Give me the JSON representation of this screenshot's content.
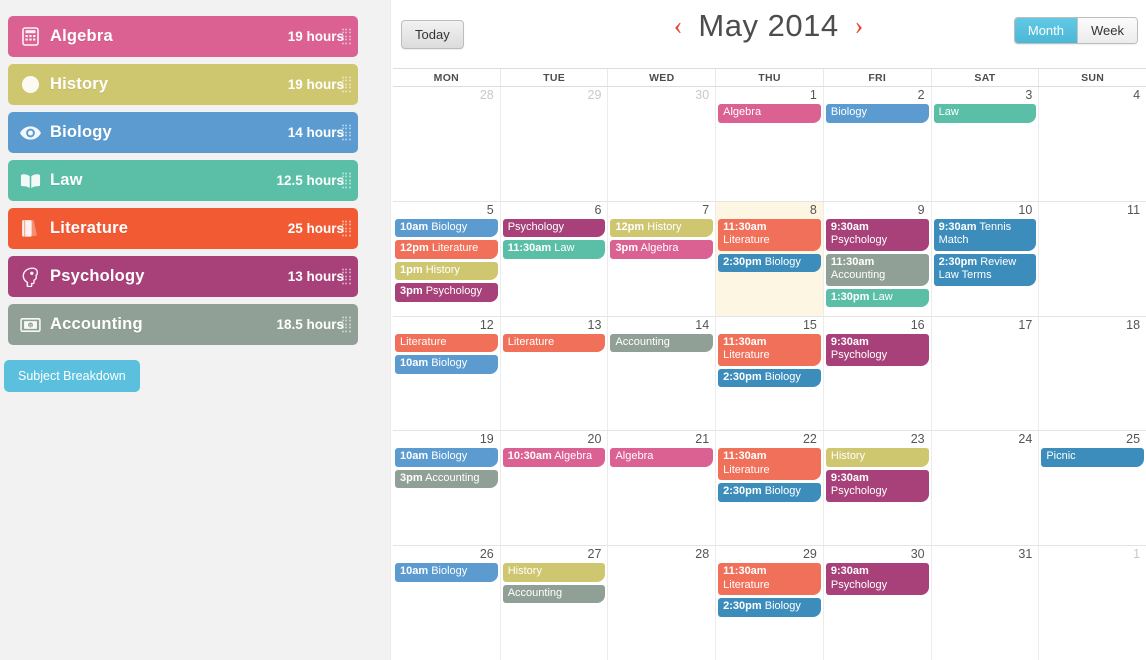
{
  "sidebar": {
    "subjects": [
      {
        "name": "Algebra",
        "hours": "19 hours",
        "color": "#da6191",
        "icon": "calculator-icon"
      },
      {
        "name": "History",
        "hours": "19 hours",
        "color": "#cfc670",
        "icon": "globe-icon"
      },
      {
        "name": "Biology",
        "hours": "14 hours",
        "color": "#5b9bd0",
        "icon": "eye-icon"
      },
      {
        "name": "Law",
        "hours": "12.5 hours",
        "color": "#5bbfa8",
        "icon": "open-book-icon"
      },
      {
        "name": "Literature",
        "hours": "25 hours",
        "color": "#f15a33",
        "icon": "books-icon"
      },
      {
        "name": "Psychology",
        "hours": "13 hours",
        "color": "#a8417a",
        "icon": "brain-icon"
      },
      {
        "name": "Accounting",
        "hours": "18.5 hours",
        "color": "#91a096",
        "icon": "money-icon"
      }
    ],
    "breakdown_button": "Subject Breakdown"
  },
  "toolbar": {
    "today_label": "Today",
    "prev_arrow": "‹",
    "next_arrow": "›",
    "title": "May 2014",
    "views": [
      {
        "label": "Month",
        "active": true
      },
      {
        "label": "Week",
        "active": false
      }
    ],
    "accent_color": "#e8432f",
    "active_view_color": "#4bb8d6"
  },
  "calendar": {
    "day_headers": [
      "MON",
      "TUE",
      "WED",
      "THU",
      "FRI",
      "SAT",
      "SUN"
    ],
    "event_colors": {
      "Algebra": "#da6191",
      "History": "#cfc670",
      "Biology": "#5b9bd0",
      "Law": "#5bbfa8",
      "Literature": "#f0705a",
      "Psychology": "#a8417a",
      "Accounting": "#91a096",
      "Other": "#3c8dbc"
    },
    "today": 8,
    "weeks": [
      [
        {
          "num": "28",
          "other": true,
          "events": []
        },
        {
          "num": "29",
          "other": true,
          "events": []
        },
        {
          "num": "30",
          "other": true,
          "events": []
        },
        {
          "num": "1",
          "other": false,
          "events": [
            {
              "time": "",
              "name": "Algebra",
              "color": "#da6191"
            }
          ]
        },
        {
          "num": "2",
          "other": false,
          "events": [
            {
              "time": "",
              "name": "Biology",
              "color": "#5b9bd0"
            }
          ]
        },
        {
          "num": "3",
          "other": false,
          "events": [
            {
              "time": "",
              "name": "Law",
              "color": "#5bbfa8"
            }
          ]
        },
        {
          "num": "4",
          "other": false,
          "events": []
        }
      ],
      [
        {
          "num": "5",
          "other": false,
          "events": [
            {
              "time": "10am",
              "name": "Biology",
              "color": "#5b9bd0"
            },
            {
              "time": "12pm",
              "name": "Literature",
              "color": "#f0705a"
            },
            {
              "time": "1pm",
              "name": "History",
              "color": "#cfc670"
            },
            {
              "time": "3pm",
              "name": "Psychology",
              "color": "#a8417a"
            }
          ]
        },
        {
          "num": "6",
          "other": false,
          "events": [
            {
              "time": "",
              "name": "Psychology",
              "color": "#a8417a"
            },
            {
              "time": "11:30am",
              "name": "Law",
              "color": "#5bbfa8"
            }
          ]
        },
        {
          "num": "7",
          "other": false,
          "events": [
            {
              "time": "12pm",
              "name": "History",
              "color": "#cfc670"
            },
            {
              "time": "3pm",
              "name": "Algebra",
              "color": "#da6191"
            }
          ]
        },
        {
          "num": "8",
          "other": false,
          "today": true,
          "events": [
            {
              "time": "11:30am",
              "name": "Literature",
              "color": "#f0705a"
            },
            {
              "time": "2:30pm",
              "name": "Biology",
              "color": "#3c8dbc"
            }
          ]
        },
        {
          "num": "9",
          "other": false,
          "events": [
            {
              "time": "9:30am",
              "name": "Psychology",
              "color": "#a8417a"
            },
            {
              "time": "11:30am",
              "name": "Accounting",
              "color": "#91a096"
            },
            {
              "time": "1:30pm",
              "name": "Law",
              "color": "#5bbfa8"
            }
          ]
        },
        {
          "num": "10",
          "other": false,
          "events": [
            {
              "time": "9:30am",
              "name": "Tennis Match",
              "color": "#3c8dbc"
            },
            {
              "time": "2:30pm",
              "name": "Review Law Terms",
              "color": "#3c8dbc"
            }
          ]
        },
        {
          "num": "11",
          "other": false,
          "events": []
        }
      ],
      [
        {
          "num": "12",
          "other": false,
          "events": [
            {
              "time": "",
              "name": "Literature",
              "color": "#f0705a"
            },
            {
              "time": "10am",
              "name": "Biology",
              "color": "#5b9bd0"
            }
          ]
        },
        {
          "num": "13",
          "other": false,
          "events": [
            {
              "time": "",
              "name": "Literature",
              "color": "#f0705a"
            }
          ]
        },
        {
          "num": "14",
          "other": false,
          "events": [
            {
              "time": "",
              "name": "Accounting",
              "color": "#91a096"
            }
          ]
        },
        {
          "num": "15",
          "other": false,
          "events": [
            {
              "time": "11:30am",
              "name": "Literature",
              "color": "#f0705a"
            },
            {
              "time": "2:30pm",
              "name": "Biology",
              "color": "#3c8dbc"
            }
          ]
        },
        {
          "num": "16",
          "other": false,
          "events": [
            {
              "time": "9:30am",
              "name": "Psychology",
              "color": "#a8417a"
            }
          ]
        },
        {
          "num": "17",
          "other": false,
          "events": []
        },
        {
          "num": "18",
          "other": false,
          "events": []
        }
      ],
      [
        {
          "num": "19",
          "other": false,
          "events": [
            {
              "time": "10am",
              "name": "Biology",
              "color": "#5b9bd0"
            },
            {
              "time": "3pm",
              "name": "Accounting",
              "color": "#91a096"
            }
          ]
        },
        {
          "num": "20",
          "other": false,
          "events": [
            {
              "time": "10:30am",
              "name": "Algebra",
              "color": "#da6191"
            }
          ]
        },
        {
          "num": "21",
          "other": false,
          "events": [
            {
              "time": "",
              "name": "Algebra",
              "color": "#da6191"
            }
          ]
        },
        {
          "num": "22",
          "other": false,
          "events": [
            {
              "time": "11:30am",
              "name": "Literature",
              "color": "#f0705a"
            },
            {
              "time": "2:30pm",
              "name": "Biology",
              "color": "#3c8dbc"
            }
          ]
        },
        {
          "num": "23",
          "other": false,
          "events": [
            {
              "time": "",
              "name": "History",
              "color": "#cfc670"
            },
            {
              "time": "9:30am",
              "name": "Psychology",
              "color": "#a8417a"
            }
          ]
        },
        {
          "num": "24",
          "other": false,
          "events": []
        },
        {
          "num": "25",
          "other": false,
          "events": [
            {
              "time": "",
              "name": "Picnic",
              "color": "#3c8dbc"
            }
          ]
        }
      ],
      [
        {
          "num": "26",
          "other": false,
          "events": [
            {
              "time": "10am",
              "name": "Biology",
              "color": "#5b9bd0"
            }
          ]
        },
        {
          "num": "27",
          "other": false,
          "events": [
            {
              "time": "",
              "name": "History",
              "color": "#cfc670"
            },
            {
              "time": "",
              "name": "Accounting",
              "color": "#91a096"
            }
          ]
        },
        {
          "num": "28",
          "other": false,
          "events": []
        },
        {
          "num": "29",
          "other": false,
          "events": [
            {
              "time": "11:30am",
              "name": "Literature",
              "color": "#f0705a"
            },
            {
              "time": "2:30pm",
              "name": "Biology",
              "color": "#3c8dbc"
            }
          ]
        },
        {
          "num": "30",
          "other": false,
          "events": [
            {
              "time": "9:30am",
              "name": "Psychology",
              "color": "#a8417a"
            }
          ]
        },
        {
          "num": "31",
          "other": false,
          "events": []
        },
        {
          "num": "1",
          "other": true,
          "events": []
        }
      ]
    ]
  }
}
